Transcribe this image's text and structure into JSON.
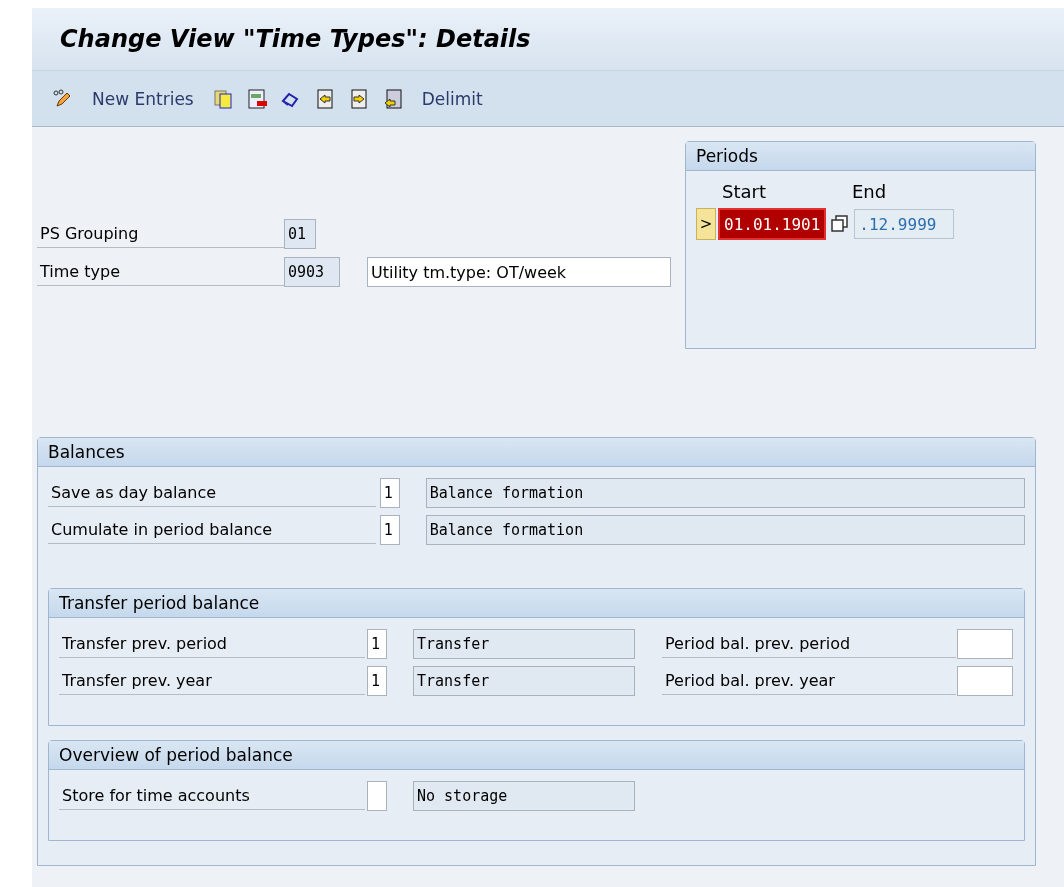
{
  "window": {
    "title": "Change View \"Time Types\": Details"
  },
  "toolbar": {
    "buttons": [
      "New Entries",
      "Delimit"
    ]
  },
  "header_fields": [
    {
      "label": "PS Grouping",
      "value": "01"
    },
    {
      "label": "Time type",
      "value": "0903",
      "description": "Utility tm.type: OT/week"
    }
  ],
  "periods": {
    "title": "Periods",
    "marker": ">",
    "start_label": "Start",
    "end_label": "End",
    "start": "01.01.1901",
    "start_error": true,
    "end": ".12.9999"
  },
  "balances": {
    "title": "Balances",
    "rows": [
      {
        "label": "Save as day balance",
        "value": "1",
        "text": "Balance formation"
      },
      {
        "label": "Cumulate in period balance",
        "value": "1",
        "text": "Balance formation"
      }
    ]
  },
  "transfer_period_balance": {
    "title": "Transfer period balance",
    "rows": [
      {
        "label": "Transfer prev. period",
        "value": "1",
        "text": "Transfer",
        "right_label": "Period bal. prev. period"
      },
      {
        "label": "Transfer prev. year",
        "value": "1",
        "text": "Transfer",
        "right_label": "Period bal. prev. year"
      }
    ]
  },
  "overview_of_period_balance": {
    "title": "Overview of period balance",
    "rows": [
      {
        "label": "Store for time accounts",
        "text": "No storage"
      }
    ]
  }
}
